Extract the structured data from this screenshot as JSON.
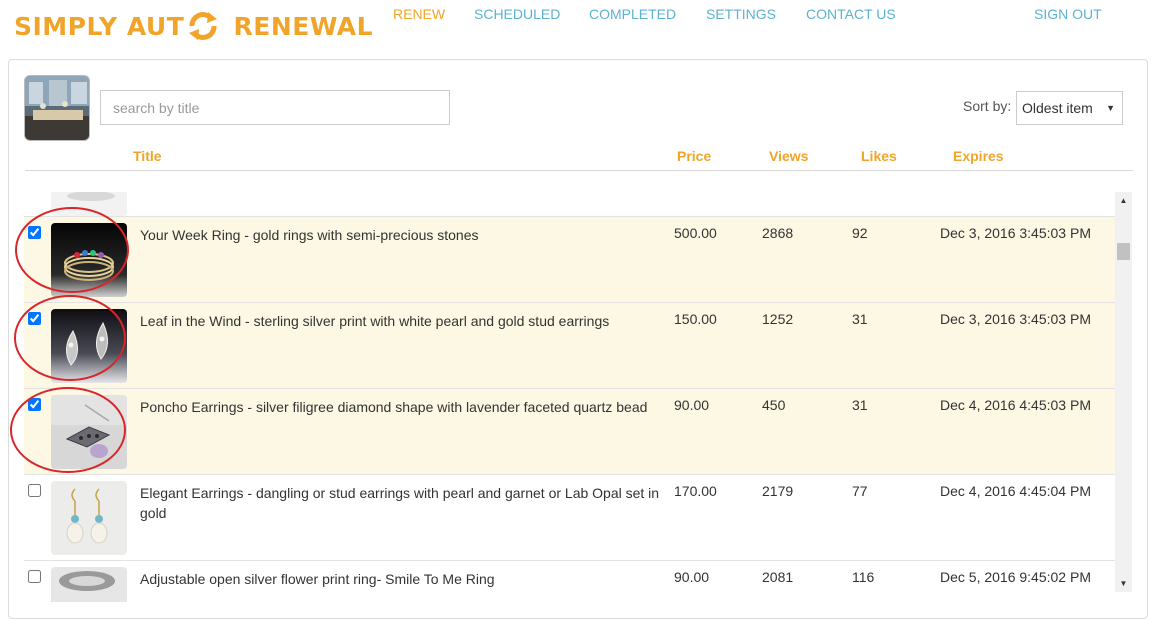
{
  "brand": {
    "text_before": "SIMPLY AUT",
    "text_after": " RENEWAL",
    "color": "#f0a52a",
    "icon": "refresh-circle-icon"
  },
  "nav": {
    "renew": "RENEW",
    "scheduled": "SCHEDULED",
    "completed": "COMPLETED",
    "settings": "SETTINGS",
    "contact": "CONTACT US",
    "signout": "SIGN OUT",
    "active": "RENEW",
    "link_color": "#5bb3d0"
  },
  "toolbar": {
    "search_placeholder": "search by title",
    "sort_label": "Sort by:",
    "sort_value": "Oldest item"
  },
  "table": {
    "headers": {
      "title": "Title",
      "price": "Price",
      "views": "Views",
      "likes": "Likes",
      "expires": "Expires"
    },
    "rows": [
      {
        "checked": true,
        "title": "Your Week Ring - gold rings with semi-precious stones",
        "price": "500.00",
        "views": "2868",
        "likes": "92",
        "expires": "Dec 3, 2016 3:45:03 PM"
      },
      {
        "checked": true,
        "title": "Leaf in the Wind - sterling silver print with white pearl and gold stud earrings",
        "price": "150.00",
        "views": "1252",
        "likes": "31",
        "expires": "Dec 3, 2016 3:45:03 PM"
      },
      {
        "checked": true,
        "title": "Poncho Earrings - silver filigree diamond shape with lavender faceted quartz bead",
        "price": "90.00",
        "views": "450",
        "likes": "31",
        "expires": "Dec 4, 2016 4:45:03 PM"
      },
      {
        "checked": false,
        "title": "Elegant Earrings - dangling or stud earrings with pearl and garnet or Lab Opal set in gold",
        "price": "170.00",
        "views": "2179",
        "likes": "77",
        "expires": "Dec 4, 2016 4:45:04 PM"
      },
      {
        "checked": false,
        "title": "Adjustable open silver flower print ring- Smile To Me Ring",
        "price": "90.00",
        "views": "2081",
        "likes": "116",
        "expires": "Dec 5, 2016 9:45:02 PM"
      }
    ]
  },
  "colors": {
    "accent": "#f0a52a",
    "selected_row": "#fcf8e3",
    "annotation": "#d9262b"
  }
}
